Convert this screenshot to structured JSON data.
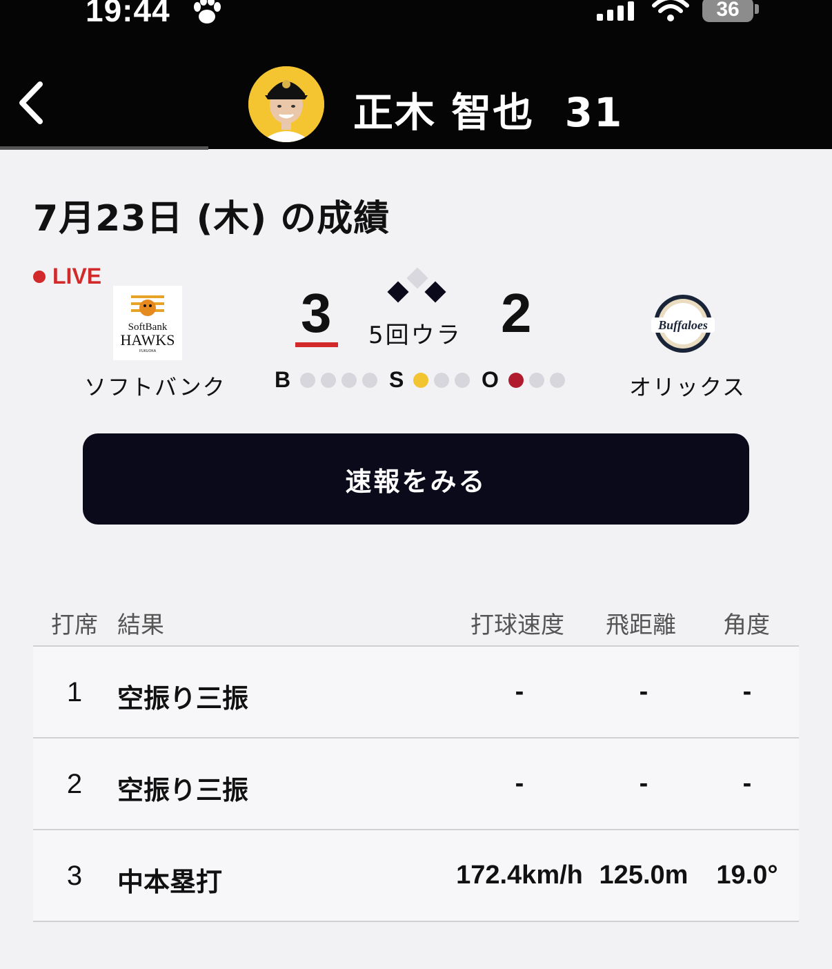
{
  "status_bar": {
    "time": "19:44",
    "battery": "36"
  },
  "header": {
    "player_name": "正木 智也",
    "player_number": "31"
  },
  "page": {
    "date_title": "7月23日 (木) の成績"
  },
  "game": {
    "live_label": "LIVE",
    "home": {
      "name": "ソフトバンク",
      "score": "3",
      "logo_text_1": "SoftBank",
      "logo_text_2": "HAWKS",
      "logo_text_3": "FUKUOKA"
    },
    "away": {
      "name": "オリックス",
      "score": "2",
      "logo_text": "Buffaloes"
    },
    "inning": "5回ウラ",
    "count": {
      "ball_label": "B",
      "strike_label": "S",
      "out_label": "O",
      "balls": 0,
      "strikes": 1,
      "outs": 1
    },
    "runners": {
      "first": true,
      "second": false,
      "third": true
    }
  },
  "cta": {
    "label": "速報をみる"
  },
  "table": {
    "headers": {
      "at_bat": "打席",
      "result": "結果",
      "speed": "打球速度",
      "distance": "飛距離",
      "angle": "角度"
    },
    "rows": [
      {
        "no": "1",
        "result": "空振り三振",
        "speed": "-",
        "distance": "-",
        "angle": "-"
      },
      {
        "no": "2",
        "result": "空振り三振",
        "speed": "-",
        "distance": "-",
        "angle": "-"
      },
      {
        "no": "3",
        "result": "中本塁打",
        "speed": "172.4km/h",
        "distance": "125.0m",
        "angle": "19.0°"
      }
    ]
  },
  "colors": {
    "accent_red": "#d22a2a",
    "cta_bg": "#0b0a1a",
    "strike_yellow": "#f2c432",
    "out_red": "#b01c2e"
  }
}
